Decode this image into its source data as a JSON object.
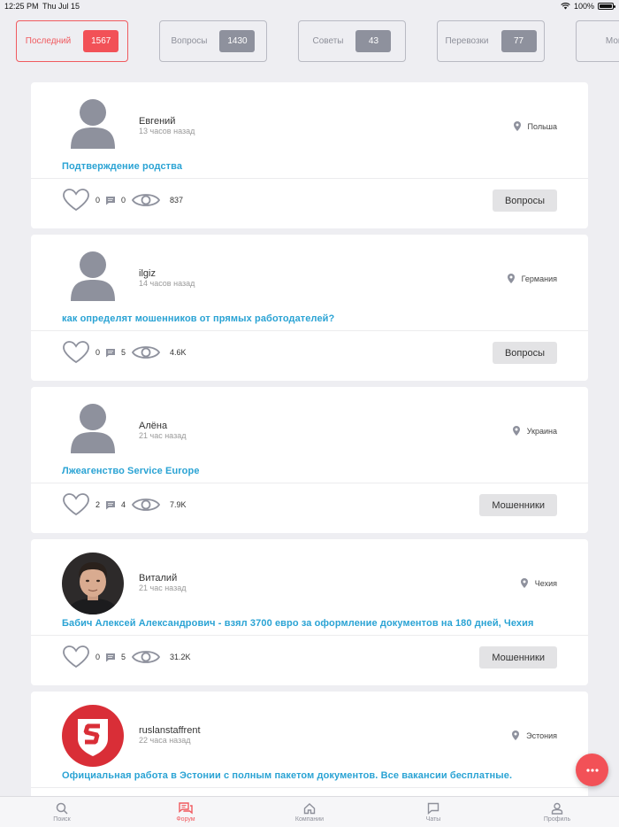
{
  "status_bar": {
    "time": "12:25 PM",
    "date": "Thu Jul 15",
    "battery": "100%"
  },
  "colors": {
    "accent": "#f25157",
    "link": "#2aa3d4",
    "muted": "#8e919d"
  },
  "tabs": [
    {
      "label": "Последний",
      "count": "1567",
      "active": true
    },
    {
      "label": "Вопросы",
      "count": "1430",
      "active": false
    },
    {
      "label": "Советы",
      "count": "43",
      "active": false
    },
    {
      "label": "Перевозки",
      "count": "77",
      "active": false
    },
    {
      "label": "Мошенники",
      "count": "",
      "active": false
    }
  ],
  "posts": [
    {
      "author": "Евгений",
      "time": "13 часов назад",
      "location": "Польша",
      "title": "Подтверждение родства",
      "likes": "0",
      "comments": "0",
      "views": "837",
      "category": "Вопросы",
      "avatar": "placeholder-person-icon"
    },
    {
      "author": "ilgiz",
      "time": "14 часов назад",
      "location": "Германия",
      "title": "как определят мошенников от прямых работодателей?",
      "likes": "0",
      "comments": "5",
      "views": "4.6K",
      "category": "Вопросы",
      "avatar": "placeholder-person-icon"
    },
    {
      "author": "Алёна",
      "time": "21 час назад",
      "location": "Украина",
      "title": "Лжеагенство Service Europe",
      "likes": "2",
      "comments": "4",
      "views": "7.9K",
      "category": "Мошенники",
      "avatar": "placeholder-person-icon"
    },
    {
      "author": "Виталий",
      "time": "21 час назад",
      "location": "Чехия",
      "title": "Бабич Алексей Александрович - взял 3700 евро за оформление документов на 180 дней, Чехия",
      "likes": "0",
      "comments": "5",
      "views": "31.2K",
      "category": "Мошенники",
      "avatar": "user-photo"
    },
    {
      "author": "ruslanstaffrent",
      "time": "22 часа назад",
      "location": "Эстония",
      "title": "Официальная работа в Эстонии с полным пакетом документов. Все вакансии бесплатные.",
      "likes": "",
      "comments": "",
      "views": "",
      "category": "",
      "avatar": "company-logo-s"
    }
  ],
  "bottom_nav": [
    {
      "label": "Поиск",
      "icon": "search-icon",
      "active": false
    },
    {
      "label": "Форум",
      "icon": "forum-icon",
      "active": true
    },
    {
      "label": "Компании",
      "icon": "home-icon",
      "active": false
    },
    {
      "label": "Чаты",
      "icon": "chat-icon",
      "active": false
    },
    {
      "label": "Профиль",
      "icon": "profile-icon",
      "active": false
    }
  ],
  "fab": {
    "icon": "more-dots-icon"
  }
}
